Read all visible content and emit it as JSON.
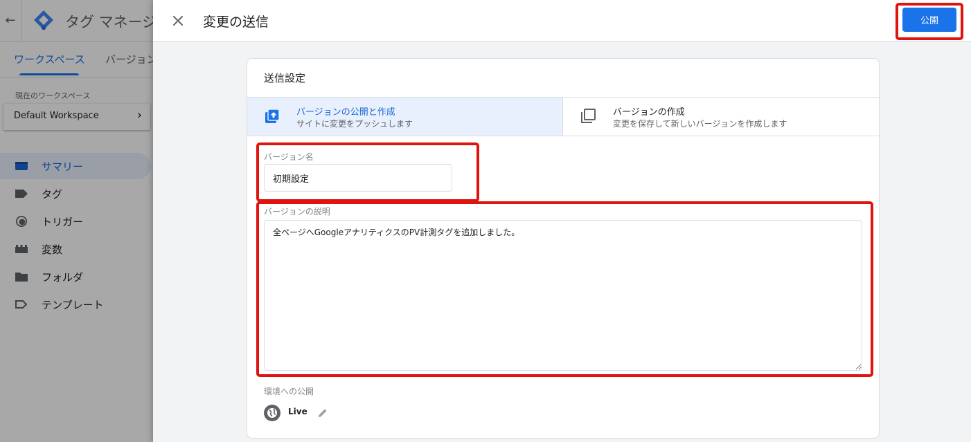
{
  "background_app": {
    "title": "タグ マネージ",
    "tabs": [
      {
        "label": "ワークスペース"
      },
      {
        "label": "バージョン"
      }
    ],
    "workspace_label": "現在のワークスペース",
    "workspace_name": "Default Workspace",
    "nav": [
      {
        "label": "サマリー",
        "icon": "summary-icon"
      },
      {
        "label": "タグ",
        "icon": "tag-icon"
      },
      {
        "label": "トリガー",
        "icon": "trigger-icon"
      },
      {
        "label": "変数",
        "icon": "variable-icon"
      },
      {
        "label": "フォルダ",
        "icon": "folder-icon"
      },
      {
        "label": "テンプレート",
        "icon": "template-icon"
      }
    ]
  },
  "dialog": {
    "title": "変更の送信",
    "publish_label": "公開",
    "settings_title": "送信設定",
    "options": [
      {
        "title": "バージョンの公開と作成",
        "subtitle": "サイトに変更をプッシュします",
        "selected": true
      },
      {
        "title": "バージョンの作成",
        "subtitle": "変更を保存して新しいバージョンを作成します",
        "selected": false
      }
    ],
    "version_name_label": "バージョン名",
    "version_name_value": "初期設定",
    "version_desc_label": "バージョンの説明",
    "version_desc_value": "全ページへGoogleアナリティクスのPV計測タグを追加しました。",
    "env_label": "環境への公開",
    "env_name": "Live"
  },
  "colors": {
    "accent": "#1a73e8",
    "selected_bg": "#e8f0fe",
    "highlight": "#e0140f"
  }
}
